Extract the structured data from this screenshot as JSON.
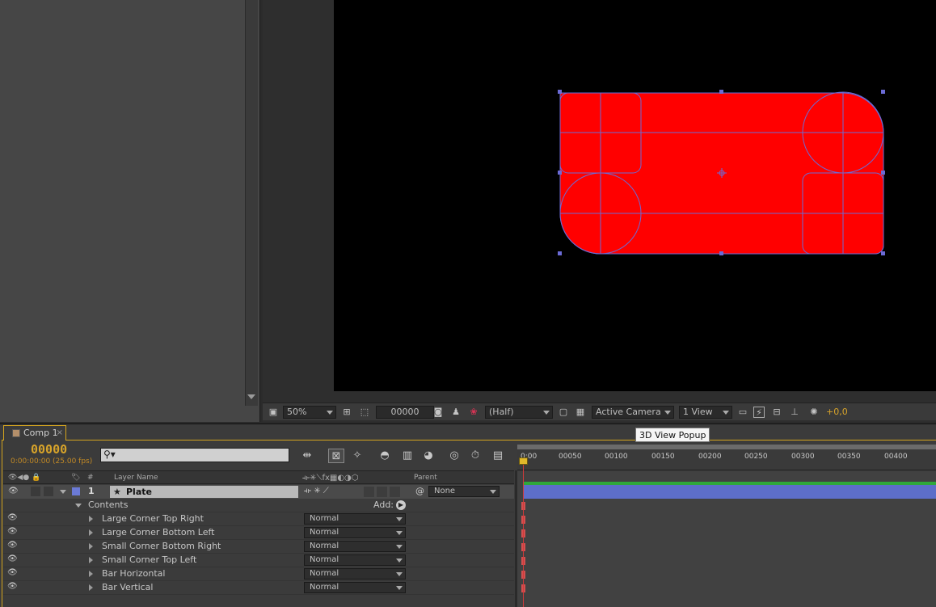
{
  "viewer_bar": {
    "magnification": "50%",
    "current_frame": "00000",
    "resolution": "(Half)",
    "camera": "Active Camera",
    "views": "1 View",
    "exposure": "+0,0"
  },
  "tooltip": "3D View Popup",
  "timeline": {
    "tab_label": "Comp 1",
    "tab_close": "×",
    "timecode": "00000",
    "timecode_sub": "0:00:00:00 (25.00 fps)",
    "columns": {
      "number": "#",
      "layer_name": "Layer Name",
      "parent": "Parent"
    },
    "layer": {
      "number": "1",
      "name": "Plate",
      "parent": "None"
    },
    "contents_label": "Contents",
    "add_label": "Add:",
    "properties": [
      {
        "name": "Large Corner Top Right",
        "mode": "Normal"
      },
      {
        "name": "Large Corner Bottom Left",
        "mode": "Normal"
      },
      {
        "name": "Small Corner Bottom Right",
        "mode": "Normal"
      },
      {
        "name": "Small Corner Top Left",
        "mode": "Normal"
      },
      {
        "name": "Bar Horizontal",
        "mode": "Normal"
      },
      {
        "name": "Bar Vertical",
        "mode": "Normal"
      }
    ],
    "ruler_ticks": [
      "00050",
      "00100",
      "00150",
      "00200",
      "00250",
      "00300",
      "00350",
      "00400"
    ],
    "ruler_start": "0:00"
  },
  "colors": {
    "shape_fill": "#ff0000",
    "path_stroke": "#6b6bd6",
    "timecode": "#d8a42a",
    "layer_bar": "#5d6ec9",
    "label_swatch": "#6b7ad6"
  },
  "icons": [
    "eye-icon",
    "audio-icon",
    "solo-icon",
    "lock-icon",
    "label-icon",
    "star-icon",
    "camera-icon",
    "search-icon",
    "stopwatch-icon",
    "graph-editor-icon",
    "motion-blur-icon",
    "brainstorm-icon"
  ]
}
